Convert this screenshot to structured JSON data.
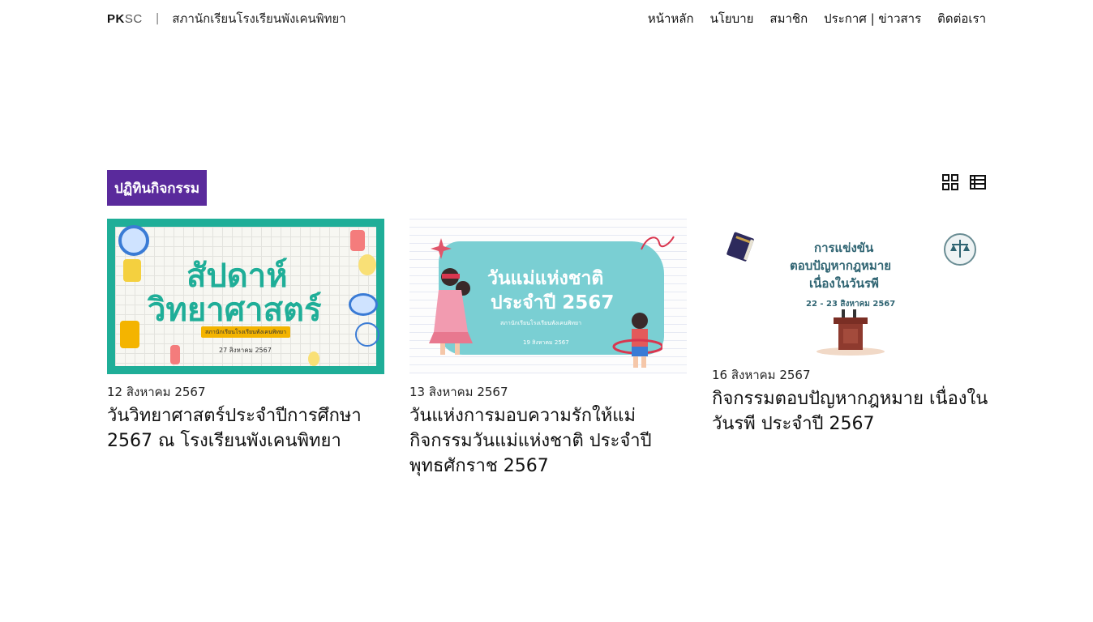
{
  "header": {
    "logo_pk": "PK",
    "logo_sc": "SC",
    "separator": "|",
    "site_name": "สภานักเรียนโรงเรียนพังเคนพิทยา",
    "nav": [
      "หน้าหลัก",
      "นโยบาย",
      "สมาชิก",
      "ประกาศ | ข่าวสาร",
      "ติดต่อเรา"
    ]
  },
  "section": {
    "title": "ปฏิทินกิจกรรม",
    "views": [
      "grid-view-icon",
      "list-view-icon"
    ]
  },
  "cards": [
    {
      "date": "12 สิงหาคม 2567",
      "title": "วันวิทยาศาสตร์ประจำปีการศึกษา 2567 ณ โรงเรียนพังเคนพิทยา",
      "thumb": {
        "line1": "สัปดาห์",
        "line2": "วิทยาศาสตร์",
        "pill": "สภานักเรียนโรงเรียนพังเคนพิทยา",
        "sub": "27 สิงหาคม 2567"
      }
    },
    {
      "date": "13 สิงหาคม 2567",
      "title": "วันแห่งการมอบความรักให้แม่ กิจกรรมวันแม่แห่งชาติ ประจำปีพุทธศักราช 2567",
      "thumb": {
        "line1": "วันแม่แห่งชาติ",
        "line2": "ประจำปี 2567",
        "sub1": "สภานักเรียนโรงเรียนพังเคนพิทยา",
        "sub2": "19 สิงหาคม 2567"
      }
    },
    {
      "date": "16 สิงหาคม 2567",
      "title": "กิจกรรมตอบปัญหากฎหมาย เนื่องในวันรพี ประจำปี 2567",
      "thumb": {
        "line1": "การแข่งขัน",
        "line2": "ตอบปัญหากฎหมาย",
        "line3": "เนื่องในวันรพี",
        "line4": "22 - 23 สิงหาคม 2567"
      }
    }
  ],
  "colors": {
    "badge": "#5a2a9c",
    "teal": "#1fae98",
    "cyan": "#7acfd3",
    "law_text": "#2f6472"
  }
}
